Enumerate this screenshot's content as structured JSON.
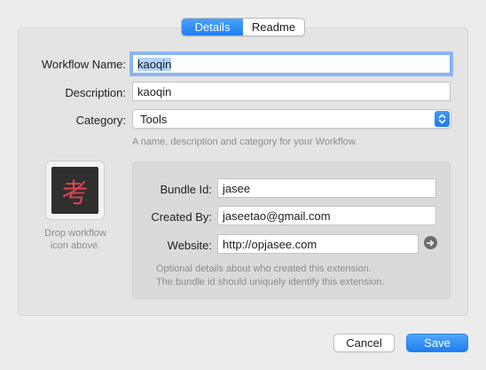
{
  "tabs": [
    {
      "label": "Details",
      "active": true
    },
    {
      "label": "Readme",
      "active": false
    }
  ],
  "form": {
    "name_label": "Workflow Name:",
    "name_value": "kaoqin",
    "description_label": "Description:",
    "description_value": "kaoqin",
    "category_label": "Category:",
    "category_value": "Tools",
    "hint": "A name, description and category for your Workflow."
  },
  "icon": {
    "glyph": "考",
    "drop_hint_line1": "Drop workflow",
    "drop_hint_line2": "icon above."
  },
  "details": {
    "bundle_label": "Bundle Id:",
    "bundle_value": "jasee",
    "created_label": "Created By:",
    "created_value": "jaseetao@gmail.com",
    "website_label": "Website:",
    "website_value": "http://opjasee.com",
    "hint_line1": "Optional details about who created this extension.",
    "hint_line2": "The bundle id should uniquely identify this extension."
  },
  "buttons": {
    "cancel": "Cancel",
    "save": "Save"
  },
  "colors": {
    "accent": "#1f7fef",
    "icon_glyph": "#d9454d"
  }
}
